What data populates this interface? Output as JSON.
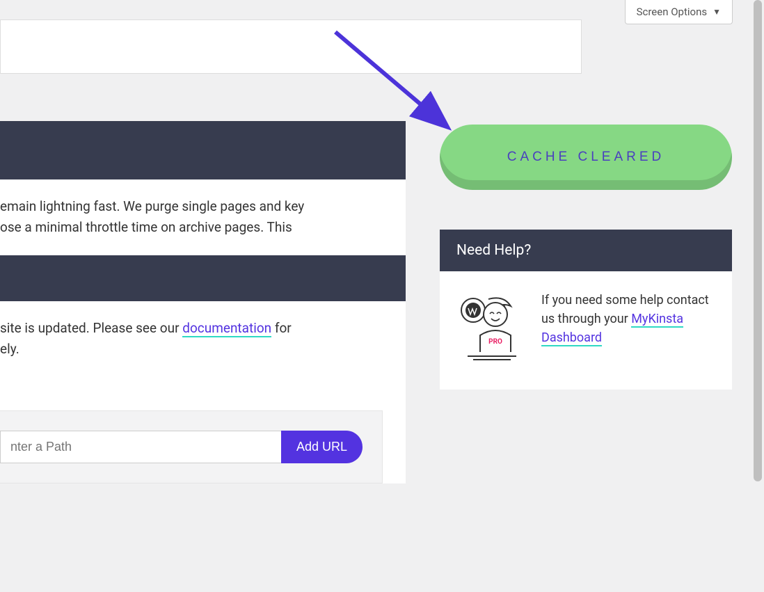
{
  "screen_options_label": "Screen Options",
  "para1_frag1": "emain lightning fast. We purge single pages and key",
  "para1_frag2": "ose a minimal throttle time on archive pages. This",
  "para2_frag1": " site is updated. Please see our ",
  "doc_link_text": "documentation",
  "para2_frag2": " for",
  "para2_frag3": "ely.",
  "url_placeholder": "nter a Path",
  "add_url_label": "Add URL",
  "cache_cleared_label": "CACHE CLEARED",
  "help_title": "Need Help?",
  "help_text_1": "If you need some help contact us through your ",
  "help_link_text": "MyKinsta Dashboard",
  "pro_badge": "PRO"
}
